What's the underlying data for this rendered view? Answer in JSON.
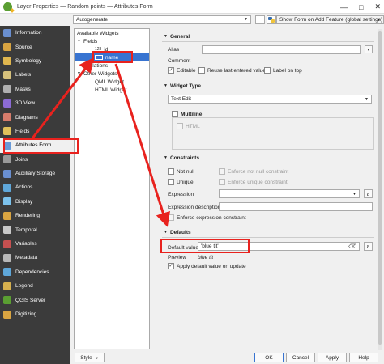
{
  "window": {
    "title": "Layer Properties — Random points — Attributes Form",
    "controls": [
      "—",
      "□",
      "✕"
    ]
  },
  "sidebar": {
    "items": [
      {
        "label": "Information",
        "icon": "information-icon",
        "color": "#6a8fd0"
      },
      {
        "label": "Source",
        "icon": "source-icon",
        "color": "#d9a441"
      },
      {
        "label": "Symbology",
        "icon": "symbology-icon",
        "color": "#e0b64e"
      },
      {
        "label": "Labels",
        "icon": "labels-icon",
        "color": "#d6c17c"
      },
      {
        "label": "Masks",
        "icon": "masks-icon",
        "color": "#b0b0b0"
      },
      {
        "label": "3D View",
        "icon": "3d-view-icon",
        "color": "#8c6bd4"
      },
      {
        "label": "Diagrams",
        "icon": "diagrams-icon",
        "color": "#d67c6b"
      },
      {
        "label": "Fields",
        "icon": "fields-icon",
        "color": "#e0c15a"
      },
      {
        "label": "Attributes Form",
        "icon": "attributes-form-icon",
        "color": "#6a9bd8"
      },
      {
        "label": "Joins",
        "icon": "joins-icon",
        "color": "#9a9a9a"
      },
      {
        "label": "Auxiliary Storage",
        "icon": "auxiliary-storage-icon",
        "color": "#6a8fd0"
      },
      {
        "label": "Actions",
        "icon": "actions-icon",
        "color": "#5fa7d9"
      },
      {
        "label": "Display",
        "icon": "display-icon",
        "color": "#7cc2ec"
      },
      {
        "label": "Rendering",
        "icon": "rendering-icon",
        "color": "#d9a441"
      },
      {
        "label": "Temporal",
        "icon": "temporal-icon",
        "color": "#c9c9c9"
      },
      {
        "label": "Variables",
        "icon": "variables-icon",
        "color": "#c55050"
      },
      {
        "label": "Metadata",
        "icon": "metadata-icon",
        "color": "#b8b8b8"
      },
      {
        "label": "Dependencies",
        "icon": "dependencies-icon",
        "color": "#5fa7d9"
      },
      {
        "label": "Legend",
        "icon": "legend-icon",
        "color": "#d6b04e"
      },
      {
        "label": "QGIS Server",
        "icon": "qgis-server-icon",
        "color": "#5a9e32"
      },
      {
        "label": "Digitizing",
        "icon": "digitizing-icon",
        "color": "#d9a441"
      }
    ]
  },
  "toolbar": {
    "layout_combo": "Autogenerate",
    "show_form_label": "Show Form on Add Feature (global settings)"
  },
  "widgets": {
    "header": "Available Widgets",
    "fields_label": "Fields",
    "field_id_type": "123",
    "field_id": "id",
    "field_name": "name",
    "relations_label": "Relations",
    "other_widgets_label": "Other Widgets",
    "qml_widget": "QML Widget",
    "html_widget": "HTML Widget"
  },
  "general": {
    "title": "General",
    "alias_label": "Alias",
    "alias_value": "",
    "comment_label": "Comment",
    "editable_label": "Editable",
    "editable_checked": true,
    "reuse_label": "Reuse last entered value",
    "reuse_checked": false,
    "label_on_top_label": "Label on top",
    "label_on_top_checked": false
  },
  "widget_type": {
    "title": "Widget Type",
    "type_value": "Text Edit",
    "multiline_label": "Multiline",
    "html_label": "HTML"
  },
  "constraints": {
    "title": "Constraints",
    "not_null_label": "Not null",
    "enforce_not_null_label": "Enforce not null constraint",
    "unique_label": "Unique",
    "enforce_unique_label": "Enforce unique constraint",
    "expression_label": "Expression",
    "expression_value": "",
    "expression_description_label": "Expression description",
    "expression_description_value": "",
    "enforce_expression_label": "Enforce expression constraint"
  },
  "defaults": {
    "title": "Defaults",
    "default_value_label": "Default value",
    "default_value": "'blue tit'",
    "preview_label": "Preview",
    "preview_value": "blue tit",
    "apply_on_update_label": "Apply default value on update",
    "apply_on_update_checked": true
  },
  "footer": {
    "style_label": "Style",
    "ok_label": "OK",
    "cancel_label": "Cancel",
    "apply_label": "Apply",
    "help_label": "Help"
  },
  "icons": {
    "collapse_arrow": "▼",
    "expand_arrow": "▶",
    "expression_symbol": "ε",
    "checkmark": "✓",
    "dropdown_arrow": "▼",
    "clear_symbol": "⌫"
  },
  "colors": {
    "annotation_red": "#e8221e",
    "selection_blue": "#3874d1",
    "sidebar_bg": "#3b3b3b"
  }
}
